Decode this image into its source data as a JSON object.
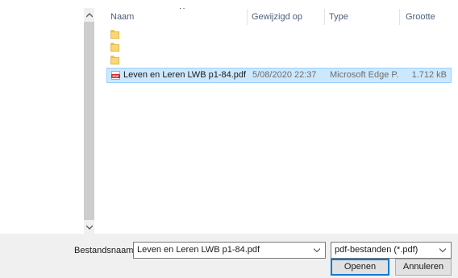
{
  "columns": {
    "name": "Naam",
    "modified": "Gewijzigd op",
    "type": "Type",
    "size": "Grootte"
  },
  "folders": [
    {
      "icon": "folder-icon"
    },
    {
      "icon": "folder-icon"
    },
    {
      "icon": "folder-icon"
    }
  ],
  "selected_file": {
    "icon": "pdf-icon",
    "icon_text": "PDF",
    "name": "Leven en Leren LWB p1-84.pdf",
    "modified": "5/08/2020 22:37",
    "type": "Microsoft Edge P...",
    "size": "1.712 kB"
  },
  "footer": {
    "filename_label": "Bestandsnaam:",
    "filename_value": "Leven en Leren LWB p1-84.pdf",
    "filter_value": "pdf-bestanden (*.pdf)",
    "open_label": "Openen",
    "cancel_label": "Annuleren"
  },
  "colors": {
    "selection_bg": "#cce8ff",
    "selection_border": "#99d1ff",
    "header_text": "#4c607a",
    "default_button_border": "#0078d7"
  }
}
